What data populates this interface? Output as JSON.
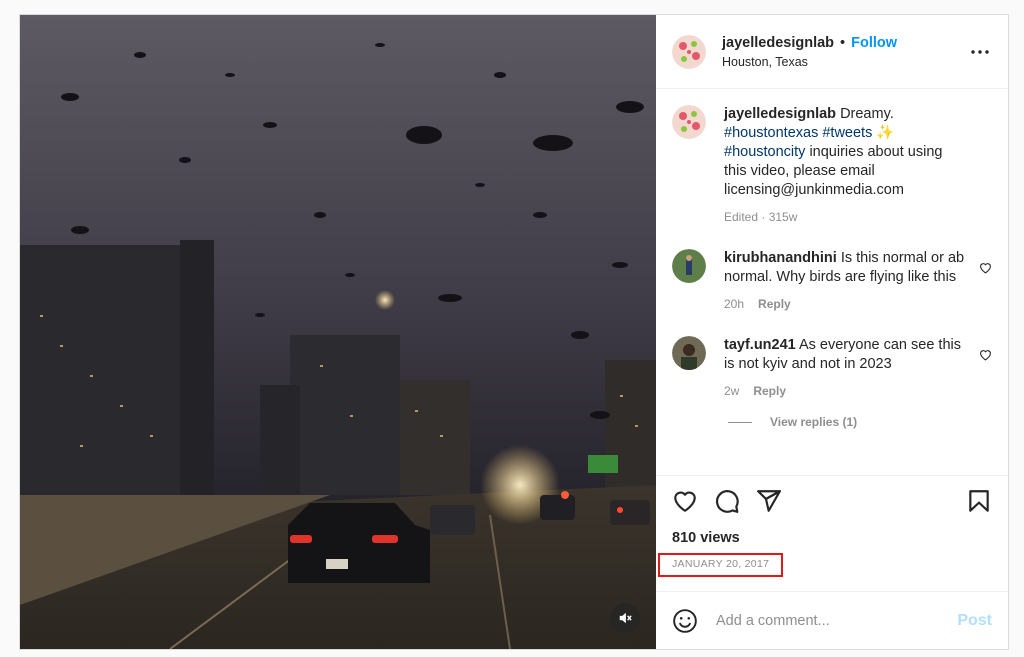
{
  "post": {
    "username": "jayelledesignlab",
    "follow_label": "Follow",
    "dot": "•",
    "location": "Houston, Texas",
    "caption": {
      "text_1": "Dreamy.",
      "hashtag_1": "#houstontexas",
      "hashtag_2": "#tweets",
      "emoji": "✨",
      "hashtag_3": "#houstoncity",
      "text_2": "inquiries about using this video, please email licensing@junkinmedia.com",
      "meta": "Edited · 315w"
    },
    "comments": [
      {
        "username": "kirubhanandhini",
        "text": "Is this normal or ab normal. Why birds are flying like this",
        "time": "20h",
        "reply_label": "Reply"
      },
      {
        "username": "tayf.un241",
        "text": "As everyone can see this is not kyiv and not in 2023",
        "time": "2w",
        "reply_label": "Reply",
        "view_replies": "View replies (1)"
      }
    ],
    "views": "810 views",
    "date": "JANUARY 20, 2017",
    "comment_placeholder": "Add a comment...",
    "post_label": "Post"
  },
  "icons": {
    "more": "more-options-icon",
    "like": "heart-icon",
    "comment": "comment-icon",
    "share": "share-icon",
    "save": "bookmark-icon",
    "mute": "speaker-muted-icon",
    "emoji": "emoji-icon"
  },
  "colors": {
    "accent": "#0095f6",
    "hashtag": "#00376b",
    "muted": "#8e8e8e",
    "highlight_box": "#e01919",
    "post_disabled": "#b2dffc"
  }
}
